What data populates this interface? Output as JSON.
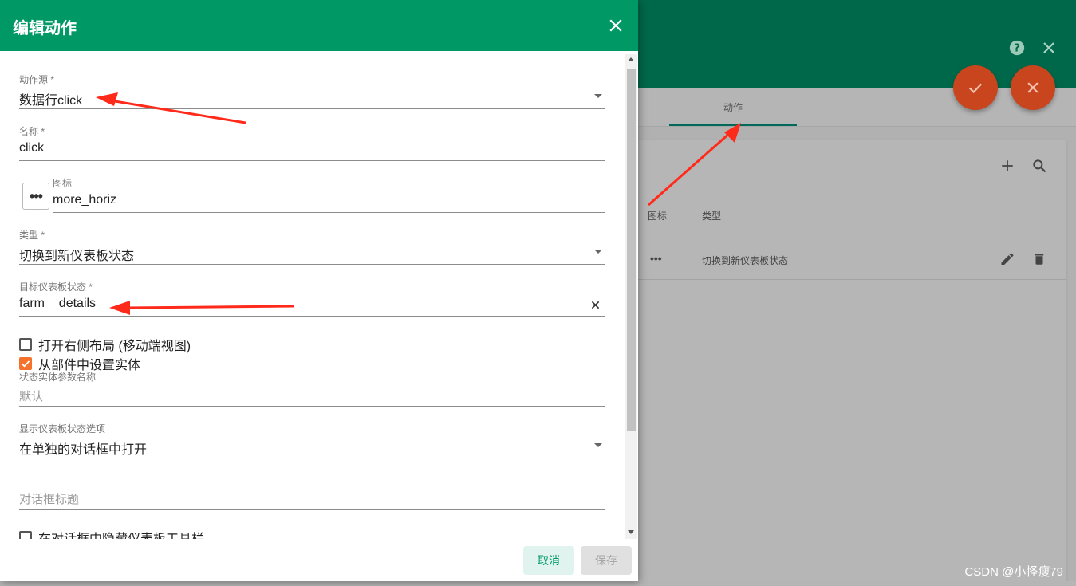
{
  "dialog": {
    "title": "编辑动作",
    "fields": {
      "action_source": {
        "label": "动作源 *",
        "value": "数据行click"
      },
      "name": {
        "label": "名称 *",
        "value": "click"
      },
      "icon": {
        "label": "图标",
        "value": "more_horiz",
        "button_glyph": "•••"
      },
      "type": {
        "label": "类型 *",
        "value": "切换到新仪表板状态"
      },
      "target_state": {
        "label": "目标仪表板状态 *",
        "value": "farm__details"
      },
      "state_entity_param": {
        "label": "状态实体参数名称",
        "placeholder": "默认"
      },
      "display_option": {
        "label": "显示仪表板状态选项",
        "value": "在单独的对话框中打开"
      },
      "dialog_title": {
        "placeholder": "对话框标题"
      }
    },
    "checkboxes": [
      {
        "label": "打开右侧布局 (移动端视图)",
        "checked": false
      },
      {
        "label": "从部件中设置实体",
        "checked": true
      },
      {
        "label": "在对话框中隐藏仪表板工具栏",
        "checked": false
      }
    ],
    "buttons": {
      "cancel": "取消",
      "save": "保存"
    }
  },
  "background": {
    "tab_label": "动作",
    "table": {
      "headers": [
        "图标",
        "类型"
      ],
      "rows": [
        {
          "icon": "•••",
          "type": "切换到新仪表板状态"
        }
      ]
    }
  },
  "watermark": "CSDN @小怪瘦79",
  "colors": {
    "dialog_header": "#009966",
    "page_header": "#00684a",
    "fab": "#c8451e",
    "checkbox_checked": "#f4722b",
    "annotation_arrow": "#ff2a1a"
  },
  "icons": [
    "close-icon",
    "help-icon",
    "check-icon",
    "plus-icon",
    "search-icon",
    "edit-icon",
    "delete-icon",
    "dropdown-arrow-icon",
    "clear-icon"
  ]
}
